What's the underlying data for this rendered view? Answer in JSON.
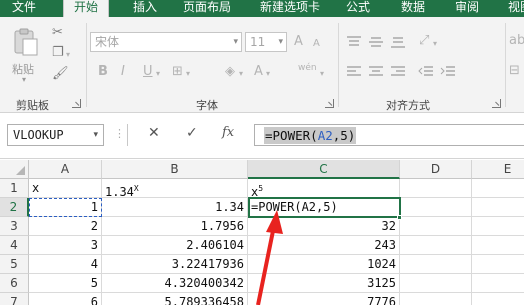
{
  "tabs": [
    {
      "label": "文件",
      "active": false
    },
    {
      "label": "开始",
      "active": true
    },
    {
      "label": "插入",
      "active": false
    },
    {
      "label": "页面布局",
      "active": false
    },
    {
      "label": "新建选项卡",
      "active": false
    },
    {
      "label": "公式",
      "active": false
    },
    {
      "label": "数据",
      "active": false
    },
    {
      "label": "审阅",
      "active": false
    },
    {
      "label": "视图",
      "active": false
    }
  ],
  "ribbon": {
    "paste_label": "粘贴",
    "clipboard_group": "剪贴板",
    "font_name": "宋体",
    "font_size": "11",
    "font_group": "字体",
    "align_group": "对齐方式",
    "bold": "B",
    "italic": "I",
    "underline": "U",
    "grow_font": "A",
    "shrink_font": "A",
    "phonetic": "wén",
    "font_color": "A"
  },
  "formula_bar": {
    "name_box": "VLOOKUP",
    "cancel": "✕",
    "confirm": "✓",
    "fx": "fx",
    "formula_prefix": "=POWER(",
    "formula_ref": "A2",
    "formula_suffix": ",5)"
  },
  "grid": {
    "columns": [
      "A",
      "B",
      "C",
      "D",
      "E"
    ],
    "selected_column": "C",
    "selected_row": "2",
    "rows": [
      {
        "num": "1",
        "a": "x",
        "b": "1.34",
        "b_sup": "X",
        "c": "x",
        "c_sup": "5",
        "d": "",
        "e": ""
      },
      {
        "num": "2",
        "a": "1",
        "b": "1.34",
        "c": "=POWER(A2,5)",
        "d": "",
        "e": ""
      },
      {
        "num": "3",
        "a": "2",
        "b": "1.7956",
        "c": "32",
        "d": "",
        "e": ""
      },
      {
        "num": "4",
        "a": "3",
        "b": "2.406104",
        "c": "243",
        "d": "",
        "e": ""
      },
      {
        "num": "5",
        "a": "4",
        "b": "3.22417936",
        "c": "1024",
        "d": "",
        "e": ""
      },
      {
        "num": "6",
        "a": "5",
        "b": "4.320400342",
        "c": "3125",
        "d": "",
        "e": ""
      },
      {
        "num": "7",
        "a": "6",
        "b": "5.789336458",
        "c": "7776",
        "d": "",
        "e": ""
      }
    ]
  },
  "colors": {
    "excel_green": "#217346",
    "arrow_red": "#e8231f",
    "reference_blue": "#2c5ec2"
  }
}
